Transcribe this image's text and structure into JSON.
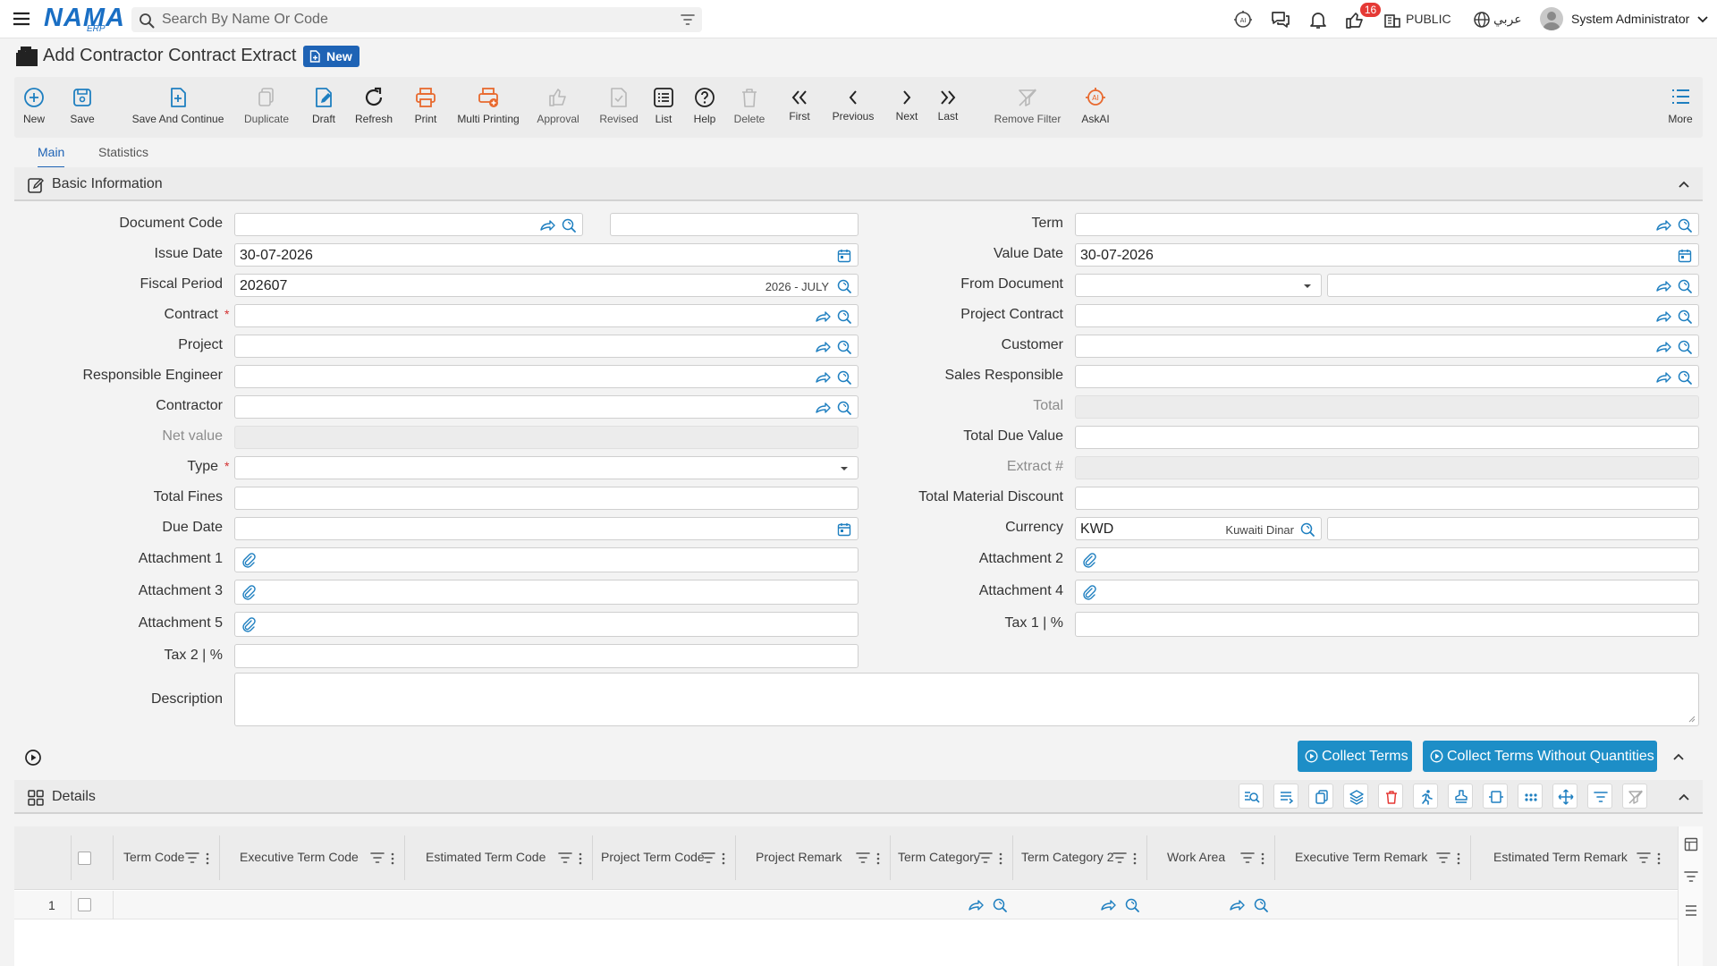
{
  "app": {
    "logo": "NAMA",
    "logo_sub": "ERP"
  },
  "search": {
    "placeholder": "Search By Name Or Code"
  },
  "topbar": {
    "notification_count": "16",
    "branch": "PUBLIC",
    "language": "عربي",
    "user_name": "System Administrator"
  },
  "page": {
    "title": "Add Contractor Contract Extract",
    "status": "New"
  },
  "toolbar": {
    "new": "New",
    "save": "Save",
    "save_continue": "Save And Continue",
    "duplicate": "Duplicate",
    "draft": "Draft",
    "refresh": "Refresh",
    "print": "Print",
    "multi_printing": "Multi Printing",
    "approval": "Approval",
    "revised": "Revised",
    "list": "List",
    "help": "Help",
    "delete": "Delete",
    "first": "First",
    "previous": "Previous",
    "next": "Next",
    "last": "Last",
    "remove_filter": "Remove Filter",
    "askai": "AskAI",
    "more": "More"
  },
  "tabs": {
    "main": "Main",
    "statistics": "Statistics"
  },
  "sections": {
    "basic": "Basic Information",
    "details": "Details"
  },
  "form": {
    "document_code": {
      "label": "Document Code",
      "value": ""
    },
    "issue_date": {
      "label": "Issue Date",
      "value": "30-07-2026"
    },
    "fiscal_period": {
      "label": "Fiscal Period",
      "value": "202607",
      "hint": "2026 - JULY"
    },
    "contract": {
      "label": "Contract",
      "value": ""
    },
    "project": {
      "label": "Project",
      "value": ""
    },
    "responsible_engineer": {
      "label": "Responsible Engineer",
      "value": ""
    },
    "contractor": {
      "label": "Contractor",
      "value": ""
    },
    "net_value": {
      "label": "Net value",
      "value": ""
    },
    "type": {
      "label": "Type",
      "value": ""
    },
    "total_fines": {
      "label": "Total Fines",
      "value": ""
    },
    "due_date": {
      "label": "Due Date",
      "value": ""
    },
    "attachment1": {
      "label": "Attachment 1"
    },
    "attachment3": {
      "label": "Attachment 3"
    },
    "attachment5": {
      "label": "Attachment 5"
    },
    "tax2": {
      "label": "Tax 2 | %",
      "value": ""
    },
    "term": {
      "label": "Term",
      "value": ""
    },
    "value_date": {
      "label": "Value Date",
      "value": "30-07-2026"
    },
    "from_document": {
      "label": "From Document",
      "value": ""
    },
    "project_contract": {
      "label": "Project Contract",
      "value": ""
    },
    "customer": {
      "label": "Customer",
      "value": ""
    },
    "sales_responsible": {
      "label": "Sales Responsible",
      "value": ""
    },
    "total": {
      "label": "Total",
      "value": ""
    },
    "total_due_value": {
      "label": "Total Due Value",
      "value": ""
    },
    "extract_no": {
      "label": "Extract #",
      "value": ""
    },
    "total_material_discount": {
      "label": "Total Material Discount",
      "value": ""
    },
    "currency": {
      "label": "Currency",
      "value": "KWD",
      "hint": "Kuwaiti Dinar"
    },
    "attachment2": {
      "label": "Attachment 2"
    },
    "attachment4": {
      "label": "Attachment 4"
    },
    "tax1": {
      "label": "Tax 1 | %",
      "value": ""
    },
    "description": {
      "label": "Description",
      "value": ""
    }
  },
  "actions": {
    "collect_terms": "Collect Terms",
    "collect_terms_no_qty": "Collect Terms Without Quantities"
  },
  "grid": {
    "columns": [
      "Term Code",
      "Executive Term Code",
      "Estimated Term Code",
      "Project Term Code",
      "Project Remark",
      "Term Category",
      "Term Category 2",
      "Work Area",
      "Executive Term Remark",
      "Estimated Term Remark"
    ],
    "rows": [
      {
        "num": "1"
      }
    ]
  },
  "colors": {
    "accent": "#1e63b5",
    "action": "#1d8ec7",
    "icon_blue": "#1e7fc0",
    "icon_orange": "#e8692e",
    "badge_red": "#e53935"
  }
}
